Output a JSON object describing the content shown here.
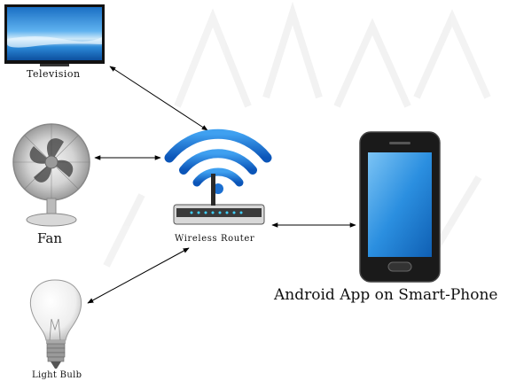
{
  "devices": {
    "television": {
      "label": "Television"
    },
    "fan": {
      "label": "Fan"
    },
    "router": {
      "label": "Wireless Router"
    },
    "phone": {
      "label": "Android App on Smart-Phone"
    },
    "bulb": {
      "label": "Light Bulb"
    }
  },
  "colors": {
    "wifi_blue": "#1b6fd0",
    "phone_screen": "#2b8fe0",
    "arrow": "#000000"
  },
  "icons": {
    "television": "television-icon",
    "fan": "fan-icon",
    "router": "wireless-router-icon",
    "phone": "smartphone-icon",
    "bulb": "light-bulb-icon"
  }
}
